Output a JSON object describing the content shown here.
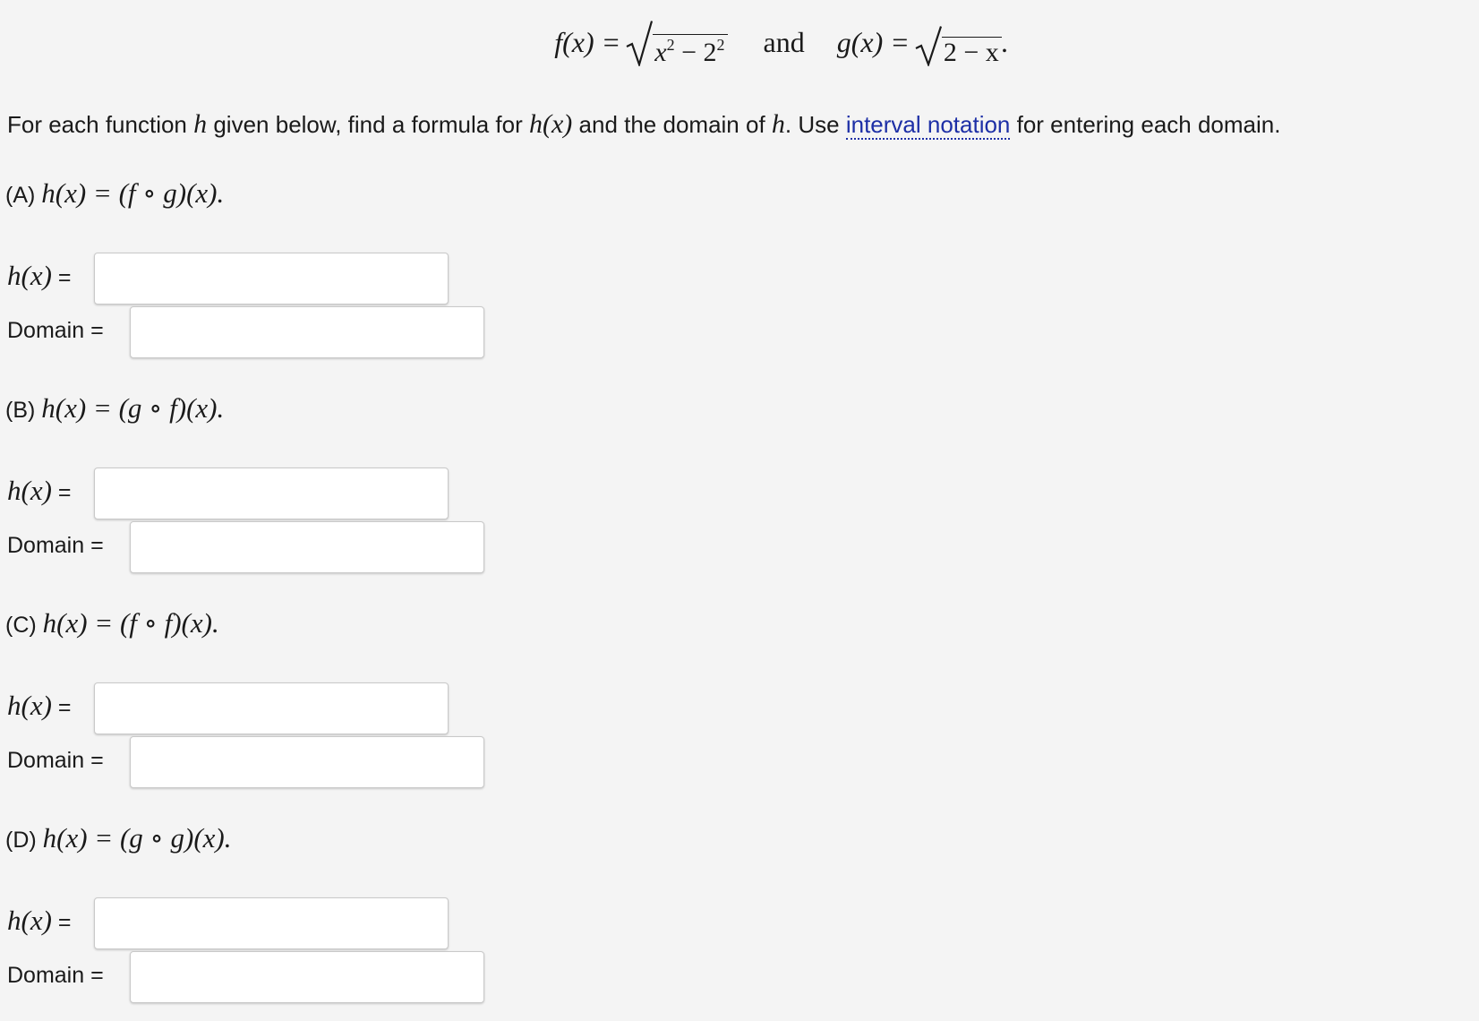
{
  "header": {
    "f_def": "f(x) = ",
    "f_radicand_base1": "x",
    "f_radicand_exp1": "2",
    "f_radicand_mid": " − 2",
    "f_radicand_exp2": "2",
    "and_word": "and",
    "g_def": "g(x) = ",
    "g_radicand": "2 − x",
    "g_period": "."
  },
  "instruction": {
    "part1": "For each function ",
    "h1": "h",
    "part2": " given below, find a formula for ",
    "hx": "h(x)",
    "part3": " and the domain of ",
    "h2": "h",
    "part4": ". Use ",
    "link_text": "interval notation",
    "part5": " for entering each domain."
  },
  "parts": [
    {
      "letter": "(A) ",
      "formula": "h(x) = (f ∘ g)(x).",
      "hx_label": "h(x)",
      "eq": " =",
      "domain_label": "Domain =",
      "hx_value": "",
      "domain_value": ""
    },
    {
      "letter": "(B) ",
      "formula": "h(x) = (g ∘ f)(x).",
      "hx_label": "h(x)",
      "eq": " =",
      "domain_label": "Domain =",
      "hx_value": "",
      "domain_value": ""
    },
    {
      "letter": "(C) ",
      "formula": "h(x) = (f ∘ f)(x).",
      "hx_label": "h(x)",
      "eq": " =",
      "domain_label": "Domain =",
      "hx_value": "",
      "domain_value": ""
    },
    {
      "letter": "(D) ",
      "formula": "h(x) = (g ∘ g)(x).",
      "hx_label": "h(x)",
      "eq": " =",
      "domain_label": "Domain =",
      "hx_value": "",
      "domain_value": ""
    }
  ]
}
